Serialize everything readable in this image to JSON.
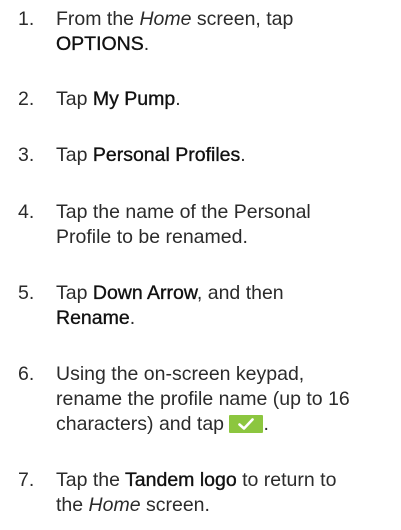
{
  "steps": [
    {
      "num": "1.",
      "pre": "From the ",
      "italic": "Home",
      "mid": " screen, tap",
      "ui": "OPTIONS",
      "post": "."
    },
    {
      "num": "2.",
      "pre": "Tap ",
      "ui": "My Pump",
      "post": "."
    },
    {
      "num": "3.",
      "pre": "Tap ",
      "ui": "Personal Profiles",
      "post": "."
    },
    {
      "num": "4.",
      "line1": "Tap the name of the Personal",
      "line2": "Profile to be renamed."
    },
    {
      "num": "5.",
      "pre": "Tap ",
      "ui": "Down Arrow",
      "mid": ", and then",
      "ui2": "Rename",
      "post": "."
    },
    {
      "num": "6.",
      "line1": "Using the on-screen keypad,",
      "line2": "rename the profile name (up to 16",
      "line3_pre": "characters) and tap ",
      "icon": "check-icon",
      "post": "."
    },
    {
      "num": "7.",
      "pre": "Tap the ",
      "ui": "Tandem logo",
      "mid": " to return to",
      "line2_pre": "the ",
      "italic": "Home",
      "line2_post": " screen."
    }
  ],
  "colors": {
    "text": "#2b2b2b",
    "check_button": "#8cc63f"
  }
}
